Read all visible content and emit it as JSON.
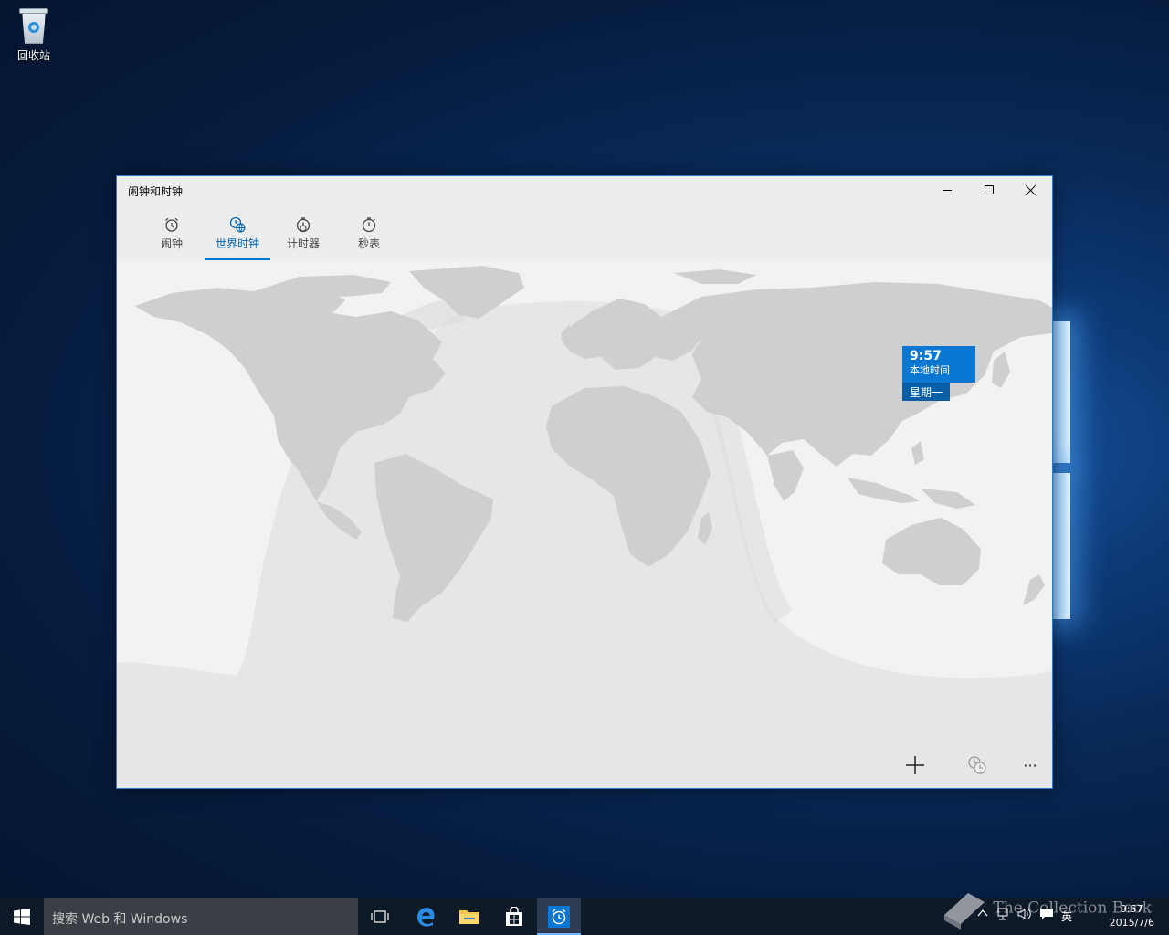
{
  "desktop": {
    "recycle_bin_label": "回收站"
  },
  "window": {
    "title": "闹钟和时钟",
    "tabs": [
      {
        "label": "闹钟",
        "icon": "alarm-icon"
      },
      {
        "label": "世界时钟",
        "icon": "world-clock-icon",
        "active": true
      },
      {
        "label": "计时器",
        "icon": "timer-icon"
      },
      {
        "label": "秒表",
        "icon": "stopwatch-icon"
      }
    ],
    "local_clock": {
      "time": "9:57",
      "label": "本地时间",
      "day": "星期一"
    },
    "appbar": {
      "add_icon": "plus-icon",
      "compare_icon": "compare-clock-icon",
      "more_label": "···"
    }
  },
  "taskbar": {
    "search_placeholder": "搜索 Web 和 Windows",
    "ime_label": "英",
    "clock_time": "9:57",
    "clock_date": "2015/7/6",
    "watermark": "The Collection Book",
    "accent": "#0078d7"
  }
}
